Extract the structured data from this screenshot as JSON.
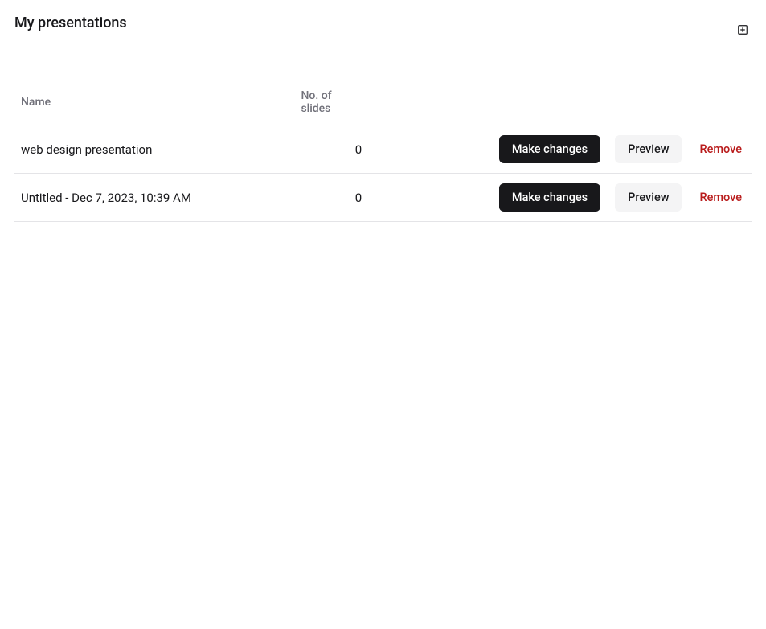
{
  "header": {
    "title": "My presentations"
  },
  "table": {
    "columns": {
      "name": "Name",
      "slides": "No. of slides"
    },
    "actions": {
      "make_changes": "Make changes",
      "preview": "Preview",
      "remove": "Remove"
    },
    "rows": [
      {
        "name": "web design presentation",
        "slides": "0"
      },
      {
        "name": "Untitled - Dec 7, 2023, 10:39 AM",
        "slides": "0"
      }
    ]
  }
}
